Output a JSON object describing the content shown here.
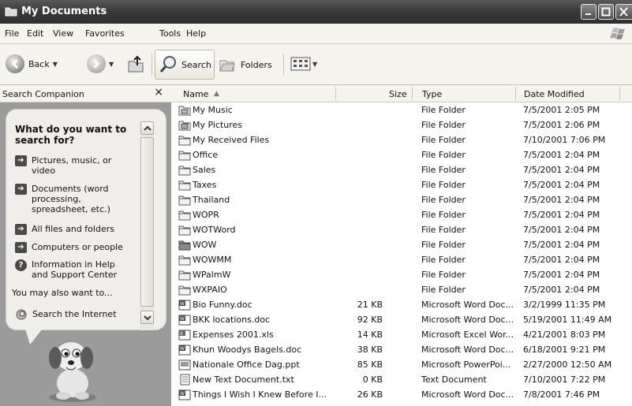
{
  "window": {
    "title": "My Documents"
  },
  "menu": [
    "File",
    "Edit",
    "View",
    "Favorites",
    "Tools",
    "Help"
  ],
  "toolbar": {
    "back_label": "Back",
    "search_label": "Search",
    "folders_label": "Folders"
  },
  "search_companion": {
    "header": "Search Companion",
    "close": "×",
    "question": "What do you want to search for?",
    "options": [
      "Pictures, music, or video",
      "Documents (word processing, spreadsheet, etc.)",
      "All files and folders",
      "Computers or people",
      "Information in Help and Support Center"
    ],
    "also_label": "You may also want to...",
    "internet_label": "Search the Internet"
  },
  "columns": {
    "name": "Name",
    "size": "Size",
    "type": "Type",
    "date": "Date Modified"
  },
  "files": [
    {
      "icon": "music-folder-icon",
      "name": "My Music",
      "size": "",
      "type": "File Folder",
      "date": "7/5/2001 2:05 PM"
    },
    {
      "icon": "pictures-folder-icon",
      "name": "My Pictures",
      "size": "",
      "type": "File Folder",
      "date": "7/5/2001 2:06 PM"
    },
    {
      "icon": "folder-icon",
      "name": "My Received Files",
      "size": "",
      "type": "File Folder",
      "date": "7/10/2001 7:06 PM"
    },
    {
      "icon": "folder-icon",
      "name": "Office",
      "size": "",
      "type": "File Folder",
      "date": "7/5/2001 2:04 PM"
    },
    {
      "icon": "folder-icon",
      "name": "Sales",
      "size": "",
      "type": "File Folder",
      "date": "7/5/2001 2:04 PM"
    },
    {
      "icon": "folder-icon",
      "name": "Taxes",
      "size": "",
      "type": "File Folder",
      "date": "7/5/2001 2:04 PM"
    },
    {
      "icon": "folder-icon",
      "name": "Thailand",
      "size": "",
      "type": "File Folder",
      "date": "7/5/2001 2:04 PM"
    },
    {
      "icon": "folder-icon",
      "name": "WOPR",
      "size": "",
      "type": "File Folder",
      "date": "7/5/2001 2:04 PM"
    },
    {
      "icon": "folder-icon",
      "name": "WOTWord",
      "size": "",
      "type": "File Folder",
      "date": "7/5/2001 2:04 PM"
    },
    {
      "icon": "shared-folder-icon",
      "name": "WOW",
      "size": "",
      "type": "File Folder",
      "date": "7/5/2001 2:04 PM"
    },
    {
      "icon": "folder-icon",
      "name": "WOWMM",
      "size": "",
      "type": "File Folder",
      "date": "7/5/2001 2:04 PM"
    },
    {
      "icon": "folder-icon",
      "name": "WPalmW",
      "size": "",
      "type": "File Folder",
      "date": "7/5/2001 2:04 PM"
    },
    {
      "icon": "folder-icon",
      "name": "WXPAIO",
      "size": "",
      "type": "File Folder",
      "date": "7/5/2001 2:04 PM"
    },
    {
      "icon": "word-doc-icon",
      "name": "Bio Funny.doc",
      "size": "21 KB",
      "type": "Microsoft Word Doc...",
      "date": "3/2/1999 11:35 PM"
    },
    {
      "icon": "word-doc-icon",
      "name": "BKK locations.doc",
      "size": "92 KB",
      "type": "Microsoft Word Doc...",
      "date": "5/19/2001 11:49 AM"
    },
    {
      "icon": "excel-icon",
      "name": "Expenses 2001.xls",
      "size": "14 KB",
      "type": "Microsoft Excel Wor...",
      "date": "4/21/2001 8:03 PM"
    },
    {
      "icon": "word-doc-icon",
      "name": "Khun Woodys Bagels.doc",
      "size": "38 KB",
      "type": "Microsoft Word Doc...",
      "date": "6/18/2001 9:21 PM"
    },
    {
      "icon": "powerpoint-icon",
      "name": "Nationale Office Dag.ppt",
      "size": "85 KB",
      "type": "Microsoft PowerPoi...",
      "date": "2/27/2000 12:50 AM"
    },
    {
      "icon": "text-doc-icon",
      "name": "New Text Document.txt",
      "size": "0 KB",
      "type": "Text Document",
      "date": "7/10/2001 7:22 PM"
    },
    {
      "icon": "word-doc-icon",
      "name": "Things I Wish I Knew Before I...",
      "size": "26 KB",
      "type": "Microsoft Word Doc...",
      "date": "7/8/2001 7:46 PM"
    }
  ]
}
